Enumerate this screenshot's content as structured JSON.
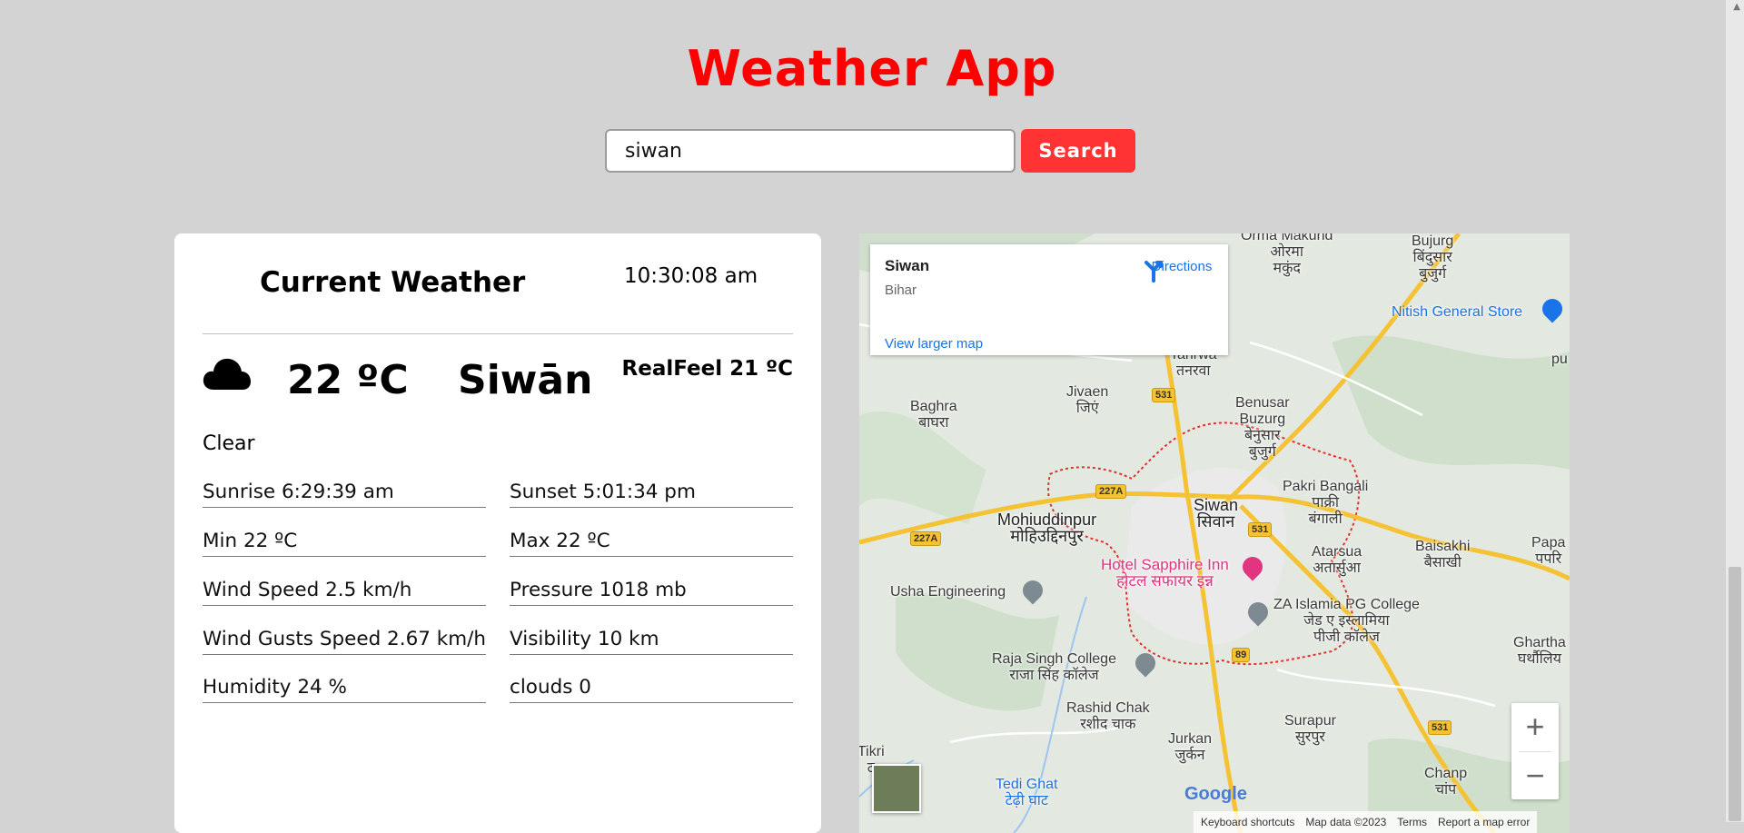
{
  "app": {
    "title": "Weather App"
  },
  "search": {
    "value": "siwan",
    "button_label": "Search"
  },
  "weather": {
    "heading": "Current Weather",
    "time": "10:30:08 am",
    "icon": "cloud-icon",
    "temperature": "22 ºC",
    "city": "Siwān",
    "realfeel": "RealFeel 21 ºC",
    "condition": "Clear",
    "stats_left": [
      "Sunrise 6:29:39 am",
      "Min 22 ºC",
      "Wind Speed 2.5 km/h",
      "Wind Gusts Speed 2.67 km/h",
      "Humidity 24 %"
    ],
    "stats_right": [
      "Sunset 5:01:34 pm",
      "Max 22 ºC",
      "Pressure 1018 mb",
      "Visibility 10 km",
      "clouds 0"
    ]
  },
  "map": {
    "place_title": "Siwan",
    "place_region": "Bihar",
    "directions_label": "Directions",
    "larger_map_link": "View larger map",
    "labels": {
      "orma": "Orma Makund\nओरमा\nमकुंद",
      "bujurg": "Bujurg\nबिंदुसार\nबुजुर्ग",
      "nitish": "Nitish General Store",
      "tanrwa": "Tanrwa\nतनरवा",
      "jivaen": "Jivaen\nजिएं",
      "baghra": "Baghra\nबाघरा",
      "benusar": "Benusar\nBuzurg\nबेनुसार\nबुजुर्ग",
      "pakri": "Pakri Bangali\nपाक्री\nबंगाली",
      "siwan": "Siwan\nसिवान",
      "mohiuddinpur": "Mohiuddinpur\nमोहिउद्दिनपुर",
      "atarsua": "Atarsua\nअतार्सुआ",
      "baisakhi": "Baisakhi\nबैसाखी",
      "papa": "Papa\nपपरि",
      "hotel": "Hotel Sapphire Inn\nहोटल सफायर इन्न",
      "usha": "Usha Engineering",
      "za": "ZA Islamia PG College\nजेड ए इस्लामिया\nपीजी कॉलेज",
      "raja": "Raja Singh College\nराजा सिंह कॉलेज",
      "ghartha": "Ghartha\nघर्थौलिय",
      "rashid": "Rashid Chak\nरशीद चाक",
      "surapur": "Surapur\nसुरपुर",
      "jurkan": "Jurkan\nजुर्कन",
      "chanp": "Chanp\nचांप",
      "tedi": "Tedi Ghat\nटेढ़ी घाट",
      "tikri": "Tikri\nट",
      "pu": "pu"
    },
    "roads": {
      "r531a": "531",
      "r531b": "531",
      "r531c": "531",
      "r227a": "227A",
      "r227b": "227A",
      "r89": "89"
    },
    "google": "Google",
    "footer": [
      "Keyboard shortcuts",
      "Map data ©2023",
      "Terms",
      "Report a map error"
    ],
    "zoom_in": "+",
    "zoom_out": "−"
  },
  "colors": {
    "title": "#ff0000",
    "button": "#ff3333",
    "map_link": "#1a73e8",
    "page_bg": "#d3d3d3"
  }
}
